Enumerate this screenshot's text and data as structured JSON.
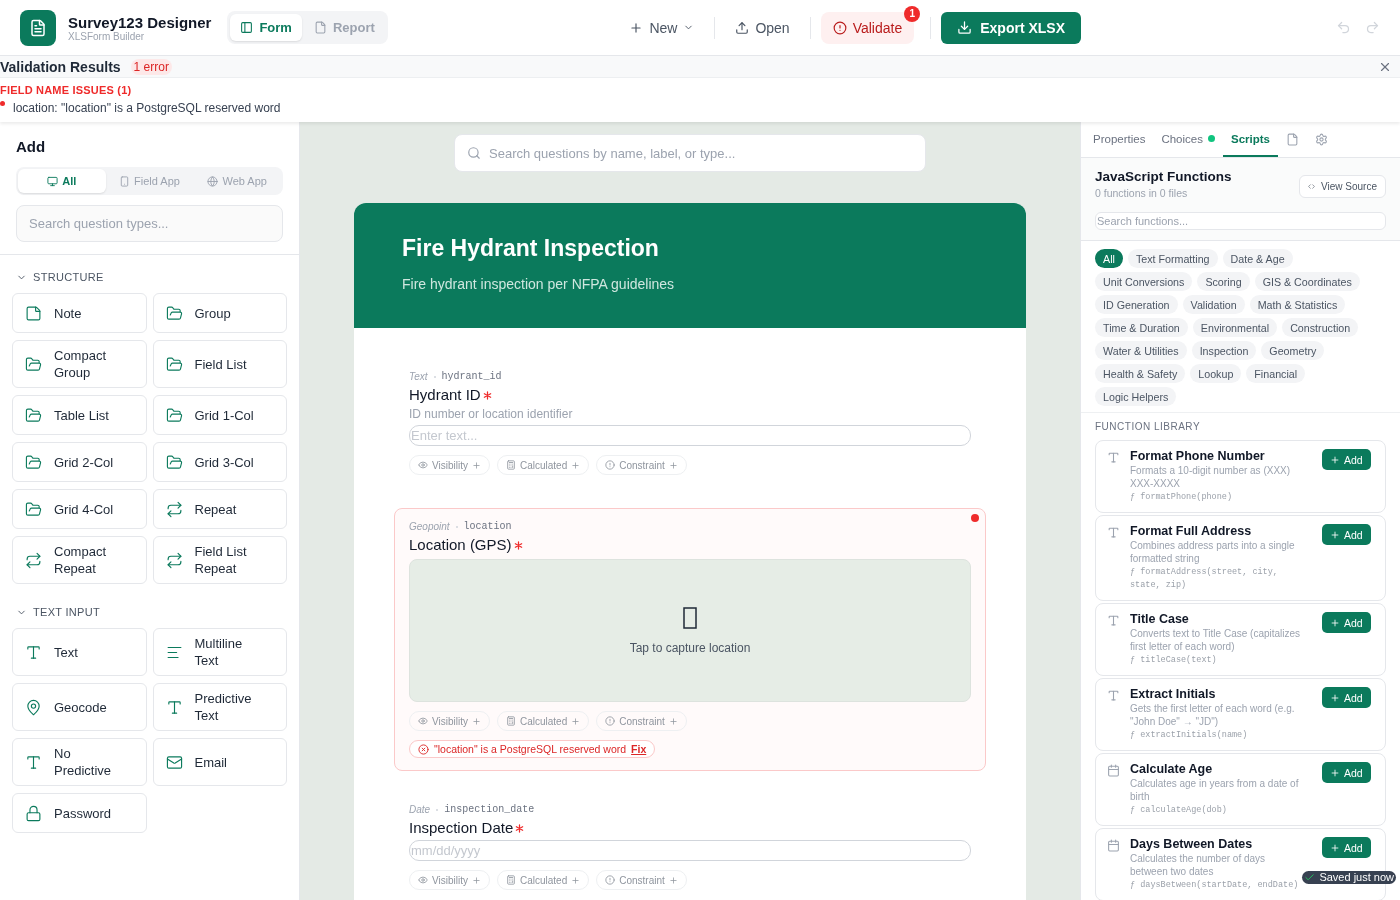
{
  "header": {
    "title": "Survey123 Designer",
    "subtitle": "XLSForm Builder",
    "view_tabs": [
      {
        "label": "Form",
        "selected": true
      },
      {
        "label": "Report",
        "selected": false
      }
    ],
    "new_label": "New",
    "open_label": "Open",
    "validate": {
      "label": "Validate",
      "badge": "1"
    },
    "export_label": "Export XLSX"
  },
  "validation": {
    "title": "Validation Results",
    "count": "1 error",
    "group": "FIELD NAME ISSUES (1)",
    "issues": [
      "location: \"location\" is a PostgreSQL reserved word"
    ]
  },
  "left": {
    "heading": "Add",
    "filters": [
      {
        "label": "All",
        "kind": "all",
        "selected": true
      },
      {
        "label": "Field App",
        "kind": "phone",
        "selected": false
      },
      {
        "label": "Web App",
        "kind": "web",
        "selected": false
      }
    ],
    "search_placeholder": "Search question types...",
    "sections": [
      {
        "title": "STRUCTURE",
        "expanded": true,
        "items": [
          {
            "label": "Note",
            "kind": "note"
          },
          {
            "label": "Group",
            "kind": "group"
          },
          {
            "label": "Compact Group",
            "kind": "group"
          },
          {
            "label": "Field List",
            "kind": "group"
          },
          {
            "label": "Table List",
            "kind": "group"
          },
          {
            "label": "Grid 1-Col",
            "kind": "group"
          },
          {
            "label": "Grid 2-Col",
            "kind": "group"
          },
          {
            "label": "Grid 3-Col",
            "kind": "group"
          },
          {
            "label": "Grid 4-Col",
            "kind": "group"
          },
          {
            "label": "Repeat",
            "kind": "repeat"
          },
          {
            "label": "Compact Repeat",
            "kind": "repeat"
          },
          {
            "label": "Field List Repeat",
            "kind": "repeat"
          }
        ]
      },
      {
        "title": "TEXT INPUT",
        "expanded": true,
        "items": [
          {
            "label": "Text",
            "kind": "text"
          },
          {
            "label": "Multiline Text",
            "kind": "multiline"
          },
          {
            "label": "Geocode",
            "kind": "geocode"
          },
          {
            "label": "Predictive Text",
            "kind": "text"
          },
          {
            "label": "No Predictive",
            "kind": "text"
          },
          {
            "label": "Email",
            "kind": "email"
          },
          {
            "label": "Password",
            "kind": "password"
          }
        ]
      }
    ]
  },
  "canvas": {
    "search_placeholder": "Search questions by name, label, or type...",
    "form_title": "Fire Hydrant Inspection",
    "form_description": "Fire hydrant inspection per NFPA guidelines",
    "questions": [
      {
        "type": "Text",
        "name": "hydrant_id",
        "label": "Hydrant ID",
        "required": true,
        "has_error": false,
        "hint": "ID number or location identifier",
        "kind": "input",
        "placeholder": "Enter text...",
        "rules": [
          {
            "label": "Visibility",
            "kind": "visibility"
          },
          {
            "label": "Calculated",
            "kind": "calculated"
          },
          {
            "label": "Constraint",
            "kind": "constraint"
          }
        ]
      },
      {
        "type": "Geopoint",
        "name": "location",
        "label": "Location (GPS)",
        "required": true,
        "has_error": true,
        "kind": "map",
        "map_text": "Tap to capture location",
        "rules": [
          {
            "label": "Visibility",
            "kind": "visibility"
          },
          {
            "label": "Calculated",
            "kind": "calculated"
          },
          {
            "label": "Constraint",
            "kind": "constraint"
          }
        ],
        "error": {
          "message": "\"location\" is a PostgreSQL reserved word",
          "fix": "Fix"
        }
      },
      {
        "type": "Date",
        "name": "inspection_date",
        "label": "Inspection Date",
        "required": true,
        "has_error": false,
        "kind": "input",
        "placeholder": "mm/dd/yyyy",
        "rules": [
          {
            "label": "Visibility",
            "kind": "visibility"
          },
          {
            "label": "Calculated",
            "kind": "calculated"
          },
          {
            "label": "Constraint",
            "kind": "constraint"
          }
        ]
      }
    ]
  },
  "right": {
    "tabs": [
      {
        "label": "Properties",
        "selected": false,
        "indicator": false
      },
      {
        "label": "Choices",
        "selected": false,
        "indicator": true
      },
      {
        "label": "Scripts",
        "selected": true,
        "indicator": false
      }
    ],
    "title": "JavaScript Functions",
    "count": "0 functions in 0 files",
    "view_source": "View Source",
    "search_placeholder": "Search functions...",
    "categories": [
      {
        "label": "All",
        "selected": true
      },
      {
        "label": "Text Formatting",
        "selected": false
      },
      {
        "label": "Date & Age",
        "selected": false
      },
      {
        "label": "Unit Conversions",
        "selected": false
      },
      {
        "label": "Scoring",
        "selected": false
      },
      {
        "label": "GIS & Coordinates",
        "selected": false
      },
      {
        "label": "ID Generation",
        "selected": false
      },
      {
        "label": "Validation",
        "selected": false
      },
      {
        "label": "Math & Statistics",
        "selected": false
      },
      {
        "label": "Time & Duration",
        "selected": false
      },
      {
        "label": "Environmental",
        "selected": false
      },
      {
        "label": "Construction",
        "selected": false
      },
      {
        "label": "Water & Utilities",
        "selected": false
      },
      {
        "label": "Inspection",
        "selected": false
      },
      {
        "label": "Geometry",
        "selected": false
      },
      {
        "label": "Health & Safety",
        "selected": false
      },
      {
        "label": "Lookup",
        "selected": false
      },
      {
        "label": "Financial",
        "selected": false
      },
      {
        "label": "Logic Helpers",
        "selected": false
      }
    ],
    "library_title": "FUNCTION LIBRARY",
    "functions": [
      {
        "name": "Format Phone Number",
        "kind": "text",
        "description": "Formats a 10-digit number as (XXX) XXX-XXXX",
        "signature": "ƒ formatPhone(phone)",
        "add_label": "Add"
      },
      {
        "name": "Format Full Address",
        "kind": "text",
        "description": "Combines address parts into a single formatted string",
        "signature": "ƒ formatAddress(street, city, state, zip)",
        "add_label": "Add"
      },
      {
        "name": "Title Case",
        "kind": "text",
        "description": "Converts text to Title Case (capitalizes first letter of each word)",
        "signature": "ƒ titleCase(text)",
        "add_label": "Add"
      },
      {
        "name": "Extract Initials",
        "kind": "text",
        "description": "Gets the first letter of each word (e.g. \"John Doe\" → \"JD\")",
        "signature": "ƒ extractInitials(name)",
        "add_label": "Add"
      },
      {
        "name": "Calculate Age",
        "kind": "date",
        "description": "Calculates age in years from a date of birth",
        "signature": "ƒ calculateAge(dob)",
        "add_label": "Add"
      },
      {
        "name": "Days Between Dates",
        "kind": "date",
        "description": "Calculates the number of days between two dates",
        "signature": "ƒ daysBetween(startDate, endDate)",
        "add_label": "Add"
      }
    ]
  },
  "toast": "Saved just now"
}
